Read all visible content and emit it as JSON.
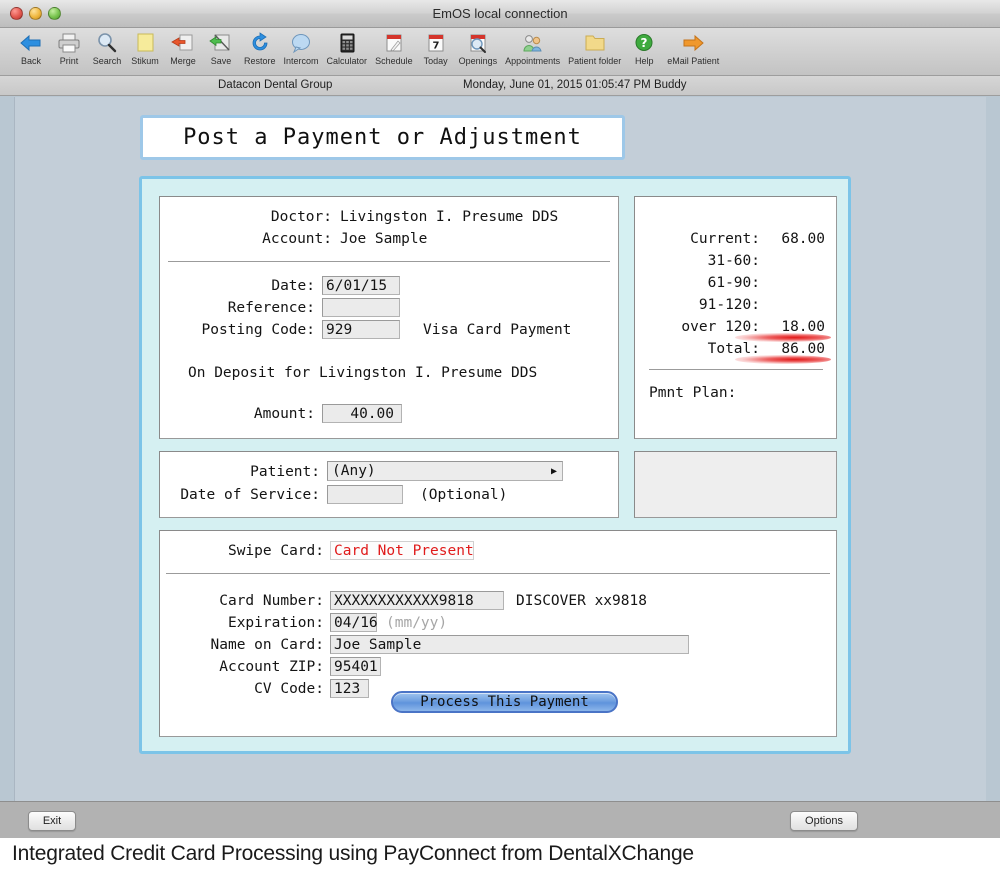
{
  "window": {
    "title": "EmOS local connection",
    "lights": [
      "close",
      "minimize",
      "zoom"
    ]
  },
  "toolbar": {
    "items": [
      {
        "label": "Back",
        "icon": "left-arrow-icon"
      },
      {
        "label": "Print",
        "icon": "printer-icon"
      },
      {
        "label": "Search",
        "icon": "magnifier-icon"
      },
      {
        "label": "Stikum",
        "icon": "sticky-note-icon"
      },
      {
        "label": "Merge",
        "icon": "merge-arrow-icon"
      },
      {
        "label": "Save",
        "icon": "save-disk-icon"
      },
      {
        "label": "Restore",
        "icon": "refresh-circle-icon"
      },
      {
        "label": "Intercom",
        "icon": "speech-bubble-icon"
      },
      {
        "label": "Calculator",
        "icon": "calculator-icon"
      },
      {
        "label": "Schedule",
        "icon": "calendar-pencil-icon"
      },
      {
        "label": "Today",
        "icon": "calendar-day-7-icon"
      },
      {
        "label": "Openings",
        "icon": "calendar-magnifier-icon"
      },
      {
        "label": "Appointments",
        "icon": "people-group-icon"
      },
      {
        "label": "Patient folder",
        "icon": "folder-icon"
      },
      {
        "label": "Help",
        "icon": "question-circle-icon"
      },
      {
        "label": "eMail Patient",
        "icon": "right-arrow-icon"
      }
    ]
  },
  "infobar": {
    "organization": "Datacon Dental Group",
    "datetime": "Monday, June 01, 2015  01:05:47 PM  Buddy"
  },
  "form": {
    "title": "Post a Payment or Adjustment",
    "payment": {
      "doctor_label": "Doctor:",
      "doctor_value": "Livingston I. Presume DDS",
      "account_label": "Account:",
      "account_value": "Joe Sample",
      "date_label": "Date:",
      "date_value": "6/01/15",
      "reference_label": "Reference:",
      "reference_value": "",
      "posting_code_label": "Posting Code:",
      "posting_code_value": "929",
      "posting_code_desc": "Visa Card Payment",
      "on_deposit_text": "On Deposit for Livingston I. Presume DDS",
      "amount_label": "Amount:",
      "amount_value": "40.00"
    },
    "aging": {
      "rows": [
        {
          "label": "Current:",
          "value": "68.00",
          "highlight": false
        },
        {
          "label": "31-60:",
          "value": "",
          "highlight": false
        },
        {
          "label": "61-90:",
          "value": "",
          "highlight": false
        },
        {
          "label": "91-120:",
          "value": "",
          "highlight": false
        },
        {
          "label": "over 120:",
          "value": "18.00",
          "highlight": true
        },
        {
          "label": "Total:",
          "value": "86.00",
          "highlight": true
        }
      ],
      "pmnt_plan_label": "Pmnt Plan:",
      "pmnt_plan_value": ""
    },
    "patient": {
      "patient_label": "Patient:",
      "patient_value": "(Any)",
      "dos_label": "Date of Service:",
      "dos_value": "",
      "dos_hint": "(Optional)"
    },
    "card": {
      "swipe_label": "Swipe Card:",
      "swipe_value": "Card Not Present",
      "card_number_label": "Card Number:",
      "card_number_value": "XXXXXXXXXXXX9818",
      "card_brand": "DISCOVER xx9818",
      "expiration_label": "Expiration:",
      "expiration_value": "04/16",
      "expiration_hint": "(mm/yy)",
      "name_label": "Name on Card:",
      "name_value": "Joe Sample",
      "zip_label": "Account ZIP:",
      "zip_value": "95401",
      "cv_label": "CV Code:",
      "cv_value": "123",
      "process_button": "Process This Payment"
    }
  },
  "footer": {
    "exit_label": "Exit",
    "options_label": "Options"
  },
  "caption": "Integrated Credit Card Processing using PayConnect from DentalXChange",
  "colors": {
    "accent_blue": "#7cc4e8",
    "panel_cyan": "#d5f0f2",
    "window_bg": "#b9c7d2",
    "alert_red": "#e01b1b",
    "button_blue": "#6e9fe0"
  }
}
